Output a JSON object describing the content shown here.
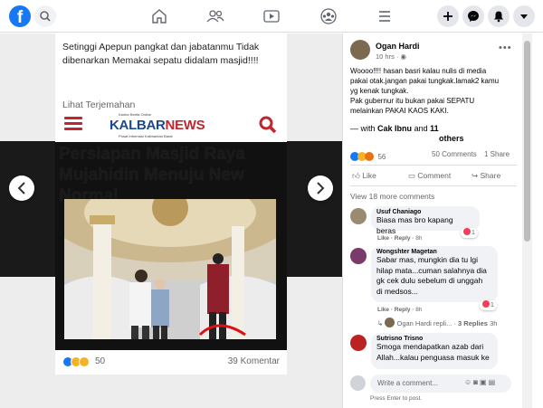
{
  "top_nav": {
    "logo_letter": "f",
    "colors": {
      "brand": "#1877f2",
      "icon": "#606770"
    }
  },
  "post_image": {
    "caption": "Setinggi Apepun pangkat dan jabatanmu Tidak dibenarkan Memakai sepatu didalam masjid!!!!",
    "translate_link": "Lihat Terjemahan",
    "news_site_small": "Kantor Berita Online",
    "news_site_name_a": "KALBAR",
    "news_site_name_b": "NEWS",
    "news_site_sub": "Pusat Informasi Kalimantan Barat",
    "headline": "Persiapan Masjid Raya Mujahidin Menuju New Normal",
    "reaction_count": "50",
    "comment_count": "39 Komentar"
  },
  "post": {
    "author": "Ogan Hardi",
    "time": "10 hrs",
    "body_lines": [
      "Woooo!!!! hasan basri kalau nulis di media",
      "pakai otak.jangan pakai tungkak.lamak2 kamu",
      "yg kenak tungkak.",
      "Pak gubernur itu bukan pakai SEPATU",
      "melainkan PAKAI KAOS KAKI."
    ],
    "with_prefix": "— with",
    "with_name": "Cak Ibnu",
    "with_and": "and",
    "with_others_num": "11",
    "with_others_word": "others",
    "reaction_count": "56",
    "comments_count": "50 Comments",
    "shares_count": "1 Share",
    "like_label": "Like",
    "comment_label": "Comment",
    "share_label": "Share",
    "view_more": "View 18 more comments"
  },
  "comments": [
    {
      "name": "Usuf Chaniago",
      "text_lines": [
        "Biasa mas bro kapang beras"
      ],
      "like": "Like",
      "reply": "Reply",
      "time": "8h",
      "react_count": "1"
    },
    {
      "name": "Wongshter Magetan",
      "text_lines": [
        "Sabar mas, mungkin dia tu lgi",
        "hilap mata...cuman salahnya dia",
        "gk cek dulu sebelum di unggah",
        "di medsos..."
      ],
      "like": "Like",
      "reply": "Reply",
      "time": "8h",
      "react_count": "1",
      "reply_preview": "Ogan Hardi repli...",
      "replies_count": "3 Replies",
      "replies_time": "3h"
    },
    {
      "name": "Sutrisno Trisno",
      "text_lines": [
        "Smoga mendapatkan azab dari",
        "Allah...kalau penguasa masuk ke"
      ]
    }
  ],
  "composer": {
    "placeholder": "Write a comment...",
    "hint": "Press Enter to post."
  }
}
